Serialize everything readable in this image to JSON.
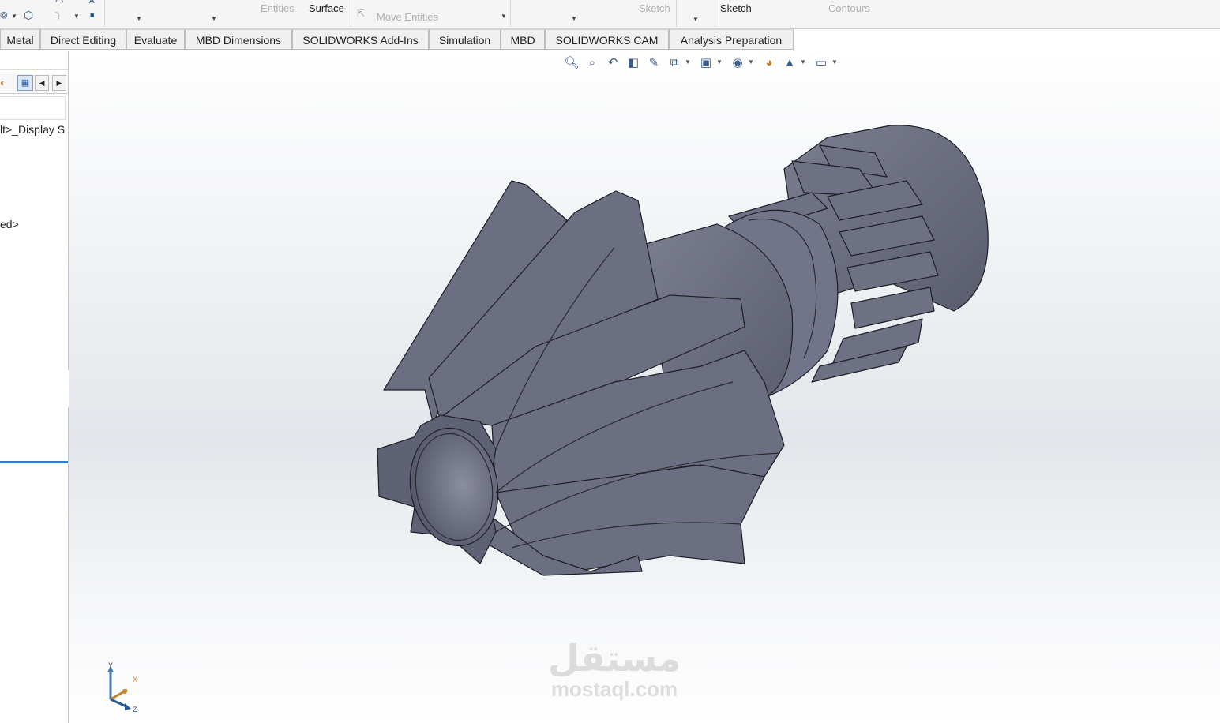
{
  "ribbon": {
    "entities_label": "Entities",
    "surface_label": "Surface",
    "move_entities_label": "Move Entities",
    "sketch_dim_label": "Sketch",
    "sketch_label": "Sketch",
    "contours_label": "Contours"
  },
  "tabs": [
    {
      "label": "Metal"
    },
    {
      "label": "Direct Editing"
    },
    {
      "label": "Evaluate"
    },
    {
      "label": "MBD Dimensions"
    },
    {
      "label": "SOLIDWORKS Add-Ins"
    },
    {
      "label": "Simulation"
    },
    {
      "label": "MBD"
    },
    {
      "label": "SOLIDWORKS CAM"
    },
    {
      "label": "Analysis Preparation"
    }
  ],
  "left_panel": {
    "row1": "lt>_Display S",
    "row2": "ed>"
  },
  "view_toolbar": {
    "icons": [
      "zoom-to-fit-icon",
      "zoom-to-area-icon",
      "previous-view-icon",
      "section-view-icon",
      "dynamic-annotation-icon",
      "view-orientation-icon",
      "display-style-icon",
      "hide-show-icon",
      "edit-appearance-icon",
      "apply-scene-icon",
      "view-settings-icon"
    ]
  },
  "triad": {
    "x_label": "X",
    "y_label": "Y",
    "z_label": "Z"
  },
  "watermark": {
    "arabic": "مستقل",
    "latin": "mostaql.com"
  },
  "colors": {
    "part_face": "#6b6e80",
    "part_edge": "#1e1e26",
    "highlight_bar": "#2e7fd0"
  }
}
